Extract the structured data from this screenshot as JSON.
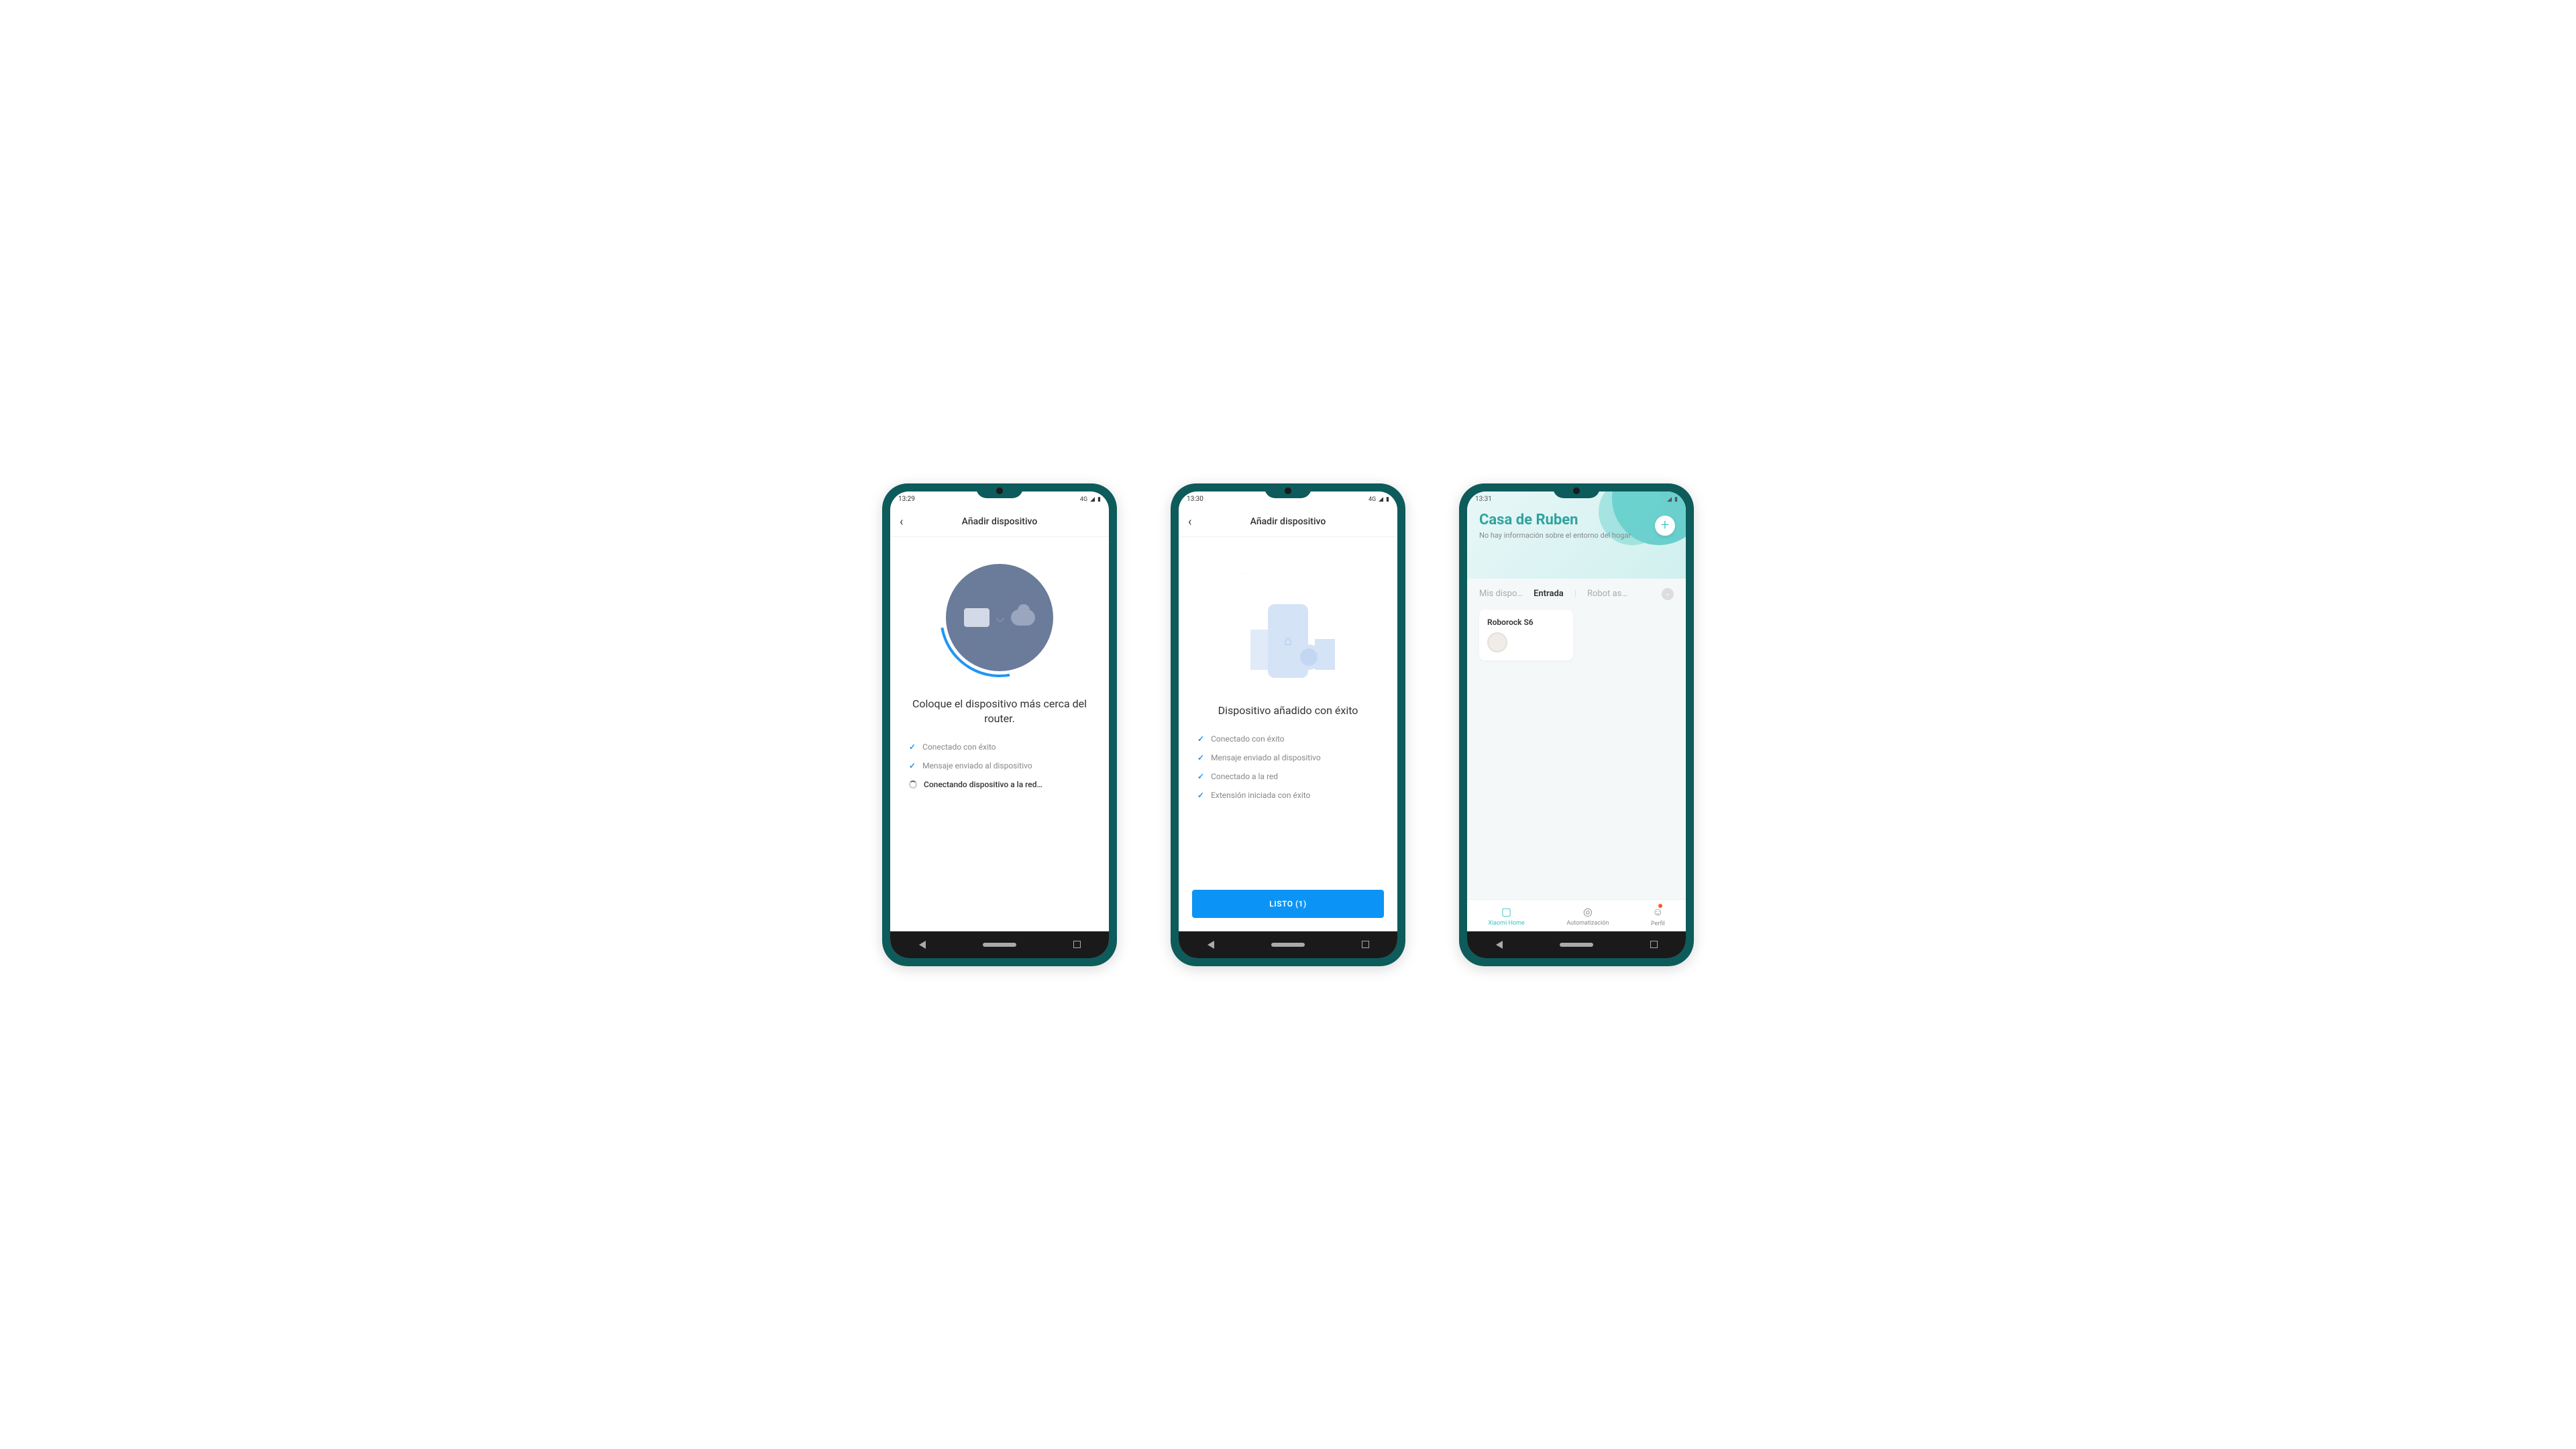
{
  "phone1": {
    "status_time": "13:29",
    "status_net": "4G",
    "appbar_title": "Añadir dispositivo",
    "heading": "Coloque el dispositivo más cerca del router.",
    "steps": [
      {
        "icon": "check",
        "text": "Conectado con éxito"
      },
      {
        "icon": "check",
        "text": "Mensaje enviado al dispositivo"
      },
      {
        "icon": "spin",
        "text": "Conectando dispositivo a la red…",
        "active": true
      }
    ]
  },
  "phone2": {
    "status_time": "13:30",
    "status_net": "4G",
    "appbar_title": "Añadir dispositivo",
    "heading": "Dispositivo añadido con éxito",
    "steps": [
      {
        "icon": "check",
        "text": "Conectado con éxito"
      },
      {
        "icon": "check",
        "text": "Mensaje enviado al dispositivo"
      },
      {
        "icon": "check",
        "text": "Conectado a la red"
      },
      {
        "icon": "check",
        "text": "Extensión iniciada con éxito"
      }
    ],
    "button": "LISTO (1)"
  },
  "phone3": {
    "status_time": "13:31",
    "home_title": "Casa de Ruben",
    "home_sub": "No hay información sobre el entorno del hogar",
    "tabs": [
      {
        "label": "Mis dispo…"
      },
      {
        "label": "Entrada",
        "active": true
      },
      {
        "label": "Robot as…"
      }
    ],
    "device": "Roborock S6",
    "bottom": [
      {
        "label": "Xiaomi Home",
        "icon": "▢",
        "active": true
      },
      {
        "label": "Automatización",
        "icon": "◎"
      },
      {
        "label": "Perfil",
        "icon": "☺",
        "badge": true
      }
    ]
  }
}
